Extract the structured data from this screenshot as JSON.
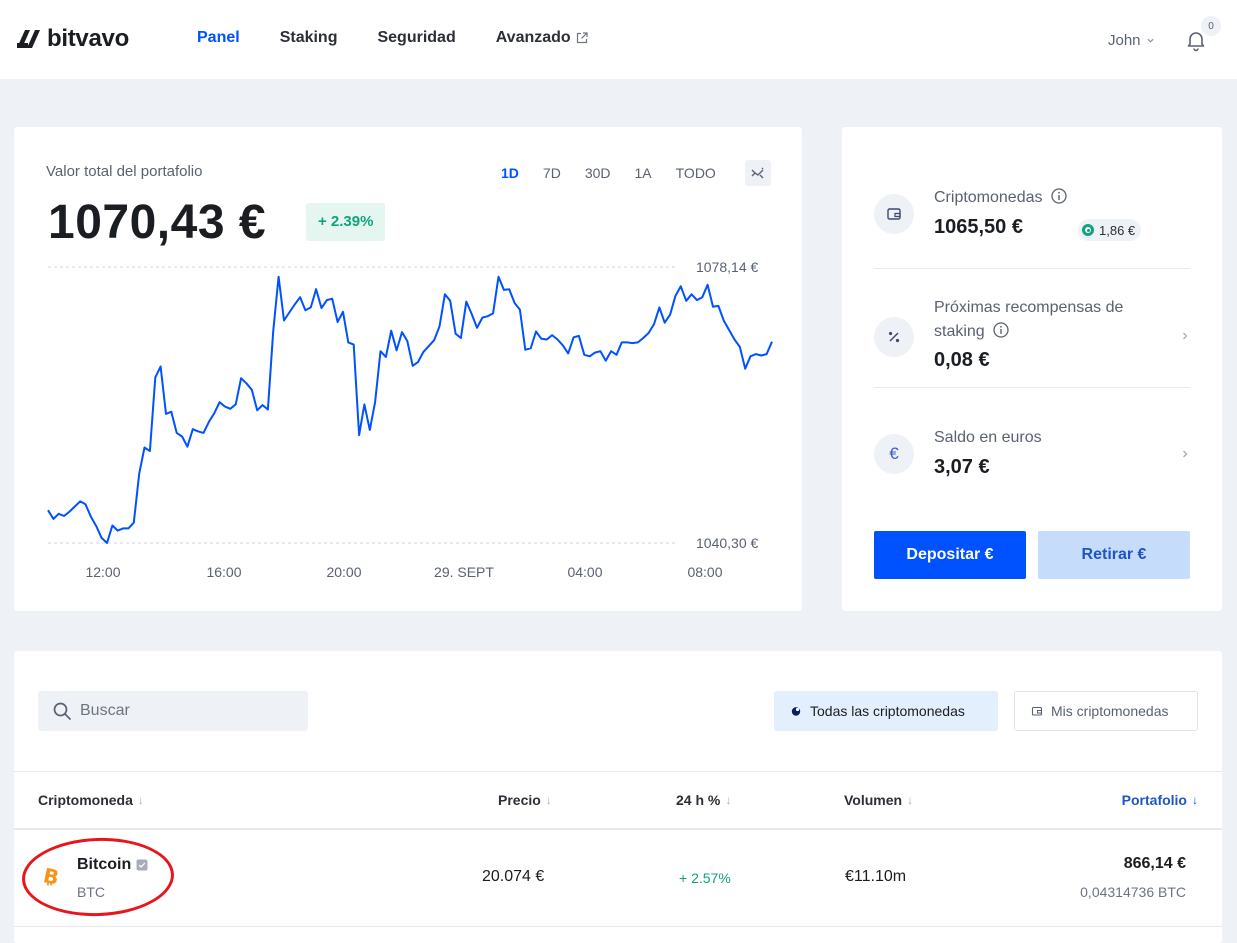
{
  "app": {
    "logo_text": "bitvavo",
    "nav": [
      {
        "label": "Panel",
        "active": true
      },
      {
        "label": "Staking",
        "active": false
      },
      {
        "label": "Seguridad",
        "active": false
      },
      {
        "label": "Avanzado",
        "active": false,
        "external": true
      }
    ],
    "user_name": "John",
    "notification_count": "0",
    "brand_color": "#0051ff"
  },
  "portfolio": {
    "label": "Valor total del portafolio",
    "value": "1070,43 €",
    "change": "+ 2.39%",
    "ranges": [
      "1D",
      "7D",
      "30D",
      "1A",
      "TODO"
    ],
    "active_range": "1D",
    "chart_icon": "chart-toggle-icon"
  },
  "chart_data": {
    "type": "line",
    "title": "",
    "xlabel": "",
    "ylabel": "",
    "x_tick_labels": [
      "12:00",
      "16:00",
      "20:00",
      "29. SEPT",
      "04:00",
      "08:00"
    ],
    "max_label": "1078,14 €",
    "min_label": "1040,30 €",
    "ylim": [
      1040.3,
      1078.14
    ],
    "grid": false,
    "series": [
      {
        "color": "#0051ff",
        "values": [
          1044.8,
          1043.6,
          1044.3,
          1044.0,
          1044.6,
          1045.3,
          1046.0,
          1045.6,
          1043.9,
          1042.6,
          1041.0,
          1040.3,
          1042.7,
          1042.0,
          1042.3,
          1042.3,
          1043.1,
          1049.8,
          1053.4,
          1052.9,
          1063.0,
          1064.5,
          1058.0,
          1058.3,
          1055.4,
          1054.9,
          1053.5,
          1055.9,
          1055.6,
          1055.4,
          1056.9,
          1058.1,
          1059.6,
          1059.0,
          1058.7,
          1059.3,
          1062.9,
          1062.2,
          1061.3,
          1058.5,
          1059.2,
          1058.6,
          1069.3,
          1076.8,
          1070.8,
          1071.9,
          1073.0,
          1074.0,
          1072.2,
          1072.6,
          1075.1,
          1072.5,
          1073.6,
          1073.8,
          1070.6,
          1072.0,
          1067.8,
          1067.5,
          1055.1,
          1059.3,
          1055.8,
          1059.6,
          1066.6,
          1065.8,
          1069.4,
          1066.7,
          1069.2,
          1068.0,
          1064.6,
          1065.1,
          1066.5,
          1067.3,
          1068.1,
          1070.0,
          1074.4,
          1073.5,
          1069.0,
          1068.4,
          1073.4,
          1071.7,
          1069.8,
          1071.2,
          1071.4,
          1071.8,
          1076.8,
          1075.0,
          1075.1,
          1073.2,
          1072.3,
          1066.8,
          1067.0,
          1069.3,
          1068.3,
          1068.2,
          1068.8,
          1068.2,
          1067.4,
          1066.3,
          1068.5,
          1068.7,
          1066.1,
          1065.9,
          1066.4,
          1066.6,
          1065.3,
          1066.6,
          1066.1,
          1067.8,
          1067.8,
          1067.7,
          1067.8,
          1068.4,
          1069.1,
          1070.3,
          1072.6,
          1070.5,
          1071.6,
          1074.2,
          1075.5,
          1073.5,
          1074.4,
          1073.6,
          1074.0,
          1075.7,
          1072.7,
          1072.8,
          1070.8,
          1069.5,
          1068.2,
          1067.2,
          1064.2,
          1065.9,
          1066.2,
          1066.0,
          1066.2,
          1067.9
        ]
      }
    ]
  },
  "summary": {
    "crypto": {
      "title": "Criptomonedas",
      "value": "1065,50 €",
      "staking": "1,86 €",
      "icon": "wallet-icon"
    },
    "rewards": {
      "title_line1": "Próximas recompensas de",
      "title_line2": "staking",
      "value": "0,08 €",
      "icon": "percent-icon"
    },
    "euros": {
      "title": "Saldo en euros",
      "value": "3,07 €",
      "icon": "euro-icon",
      "symbol": "€"
    },
    "deposit_label": "Depositar €",
    "withdraw_label": "Retirar €"
  },
  "market": {
    "search_placeholder": "Buscar",
    "filter_all": "Todas las criptomonedas",
    "filter_mine": "Mis criptomonedas",
    "columns": [
      "Criptomoneda",
      "Precio",
      "24 h %",
      "Volumen",
      "Portafolio"
    ],
    "sort_arrow": "↓",
    "rows": [
      {
        "name": "Bitcoin",
        "symbol": "BTC",
        "price": "20.074 €",
        "change_24h": "+ 2.57%",
        "volume": "€11.10m",
        "portfolio_value": "866,14 €",
        "portfolio_amount": "0,04314736 BTC",
        "icon": "bitcoin-icon"
      }
    ]
  }
}
